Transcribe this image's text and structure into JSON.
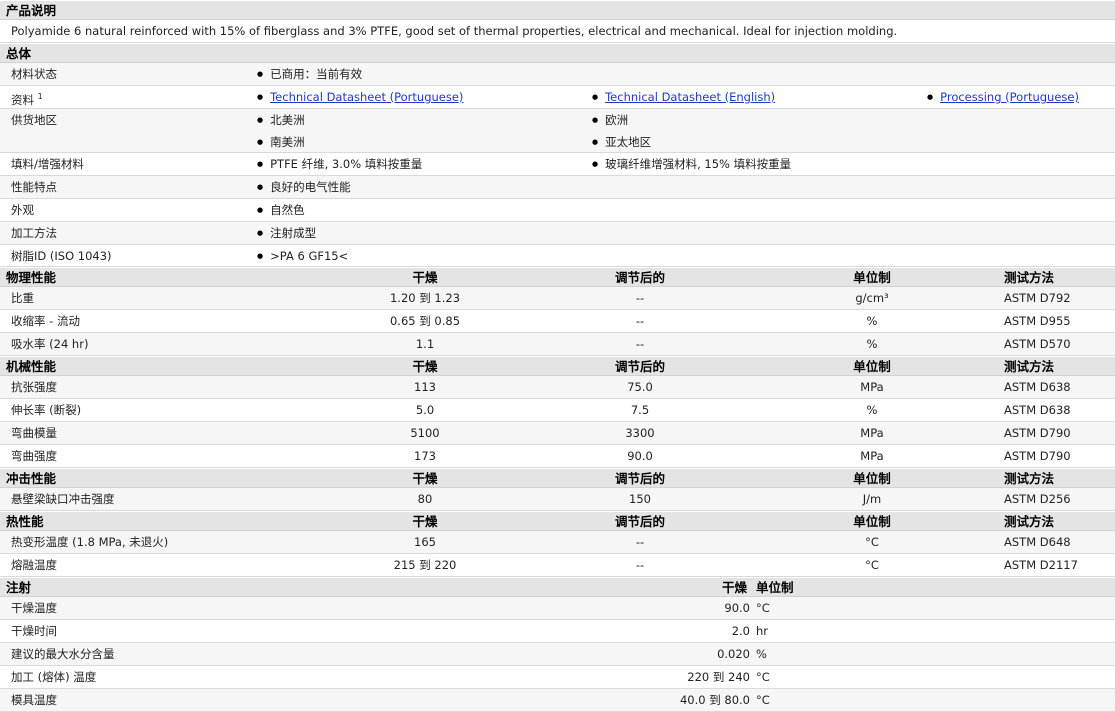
{
  "desc": {
    "header": "产品说明",
    "text": "Polyamide 6 natural reinforced with 15% of fiberglass and 3% PTFE, good set of thermal properties, electrical and mechanical. Ideal for injection molding."
  },
  "general": {
    "header": "总体",
    "status_label": "材料状态",
    "status_value": "已商用：当前有效",
    "docs_label": "资料",
    "docs_sup": "1",
    "docs": [
      "Technical Datasheet (Portuguese)",
      "Technical Datasheet (English)",
      "Processing (Portuguese)"
    ],
    "avail_label": "供货地区",
    "avail": [
      "北美洲",
      "欧洲",
      "南美洲",
      "亚太地区"
    ],
    "filler_label": "填料/增强材料",
    "filler": [
      "PTFE 纤维, 3.0% 填料按重量",
      "玻璃纤维增强材料, 15% 填料按重量"
    ],
    "feature_label": "性能特点",
    "feature_value": "良好的电气性能",
    "appear_label": "外观",
    "appear_value": "自然色",
    "process_label": "加工方法",
    "process_value": "注射成型",
    "resin_label": "树脂ID (ISO 1043)",
    "resin_value": ">PA 6 GF15<"
  },
  "columns": {
    "dry": "干燥",
    "cond": "调节后的",
    "unit": "单位制",
    "method": "测试方法"
  },
  "physical": {
    "header": "物理性能",
    "rows": [
      {
        "name": "比重",
        "dry": "1.20 到  1.23",
        "cond": "--",
        "unit": "g/cm³",
        "method": "ASTM D792"
      },
      {
        "name": "收缩率 - 流动",
        "dry": "0.65 到  0.85",
        "cond": "--",
        "unit": "%",
        "method": "ASTM D955"
      },
      {
        "name": "吸水率 (24 hr)",
        "dry": "1.1",
        "cond": "--",
        "unit": "%",
        "method": "ASTM D570"
      }
    ]
  },
  "mechanical": {
    "header": "机械性能",
    "rows": [
      {
        "name": "抗张强度",
        "dry": "113",
        "cond": "75.0",
        "unit": "MPa",
        "method": "ASTM D638"
      },
      {
        "name": "伸长率 (断裂)",
        "dry": "5.0",
        "cond": "7.5",
        "unit": "%",
        "method": "ASTM D638"
      },
      {
        "name": "弯曲模量",
        "dry": "5100",
        "cond": "3300",
        "unit": "MPa",
        "method": "ASTM D790"
      },
      {
        "name": "弯曲强度",
        "dry": "173",
        "cond": "90.0",
        "unit": "MPa",
        "method": "ASTM D790"
      }
    ]
  },
  "impact": {
    "header": "冲击性能",
    "rows": [
      {
        "name": "悬壁梁缺口冲击强度",
        "dry": "80",
        "cond": "150",
        "unit": "J/m",
        "method": "ASTM D256"
      }
    ]
  },
  "thermal": {
    "header": "热性能",
    "rows": [
      {
        "name": "热变形温度 (1.8 MPa, 未退火)",
        "dry": "165",
        "cond": "--",
        "unit": "°C",
        "method": "ASTM D648"
      },
      {
        "name": "熔融温度",
        "dry": "215 到  220",
        "cond": "--",
        "unit": "°C",
        "method": "ASTM D2117"
      }
    ]
  },
  "injection": {
    "header": "注射",
    "col_dry": "干燥",
    "col_unit": "单位制",
    "rows": [
      {
        "name": "干燥温度",
        "dry": "90.0",
        "unit": "°C"
      },
      {
        "name": "干燥时间",
        "dry": "2.0",
        "unit": "hr"
      },
      {
        "name": "建议的最大水分含量",
        "dry": "0.020",
        "unit": "%"
      },
      {
        "name": "加工 (熔体) 温度",
        "dry": "220 到  240",
        "unit": "°C"
      },
      {
        "name": "模具温度",
        "dry": "40.0 到  80.0",
        "unit": "°C"
      }
    ]
  }
}
